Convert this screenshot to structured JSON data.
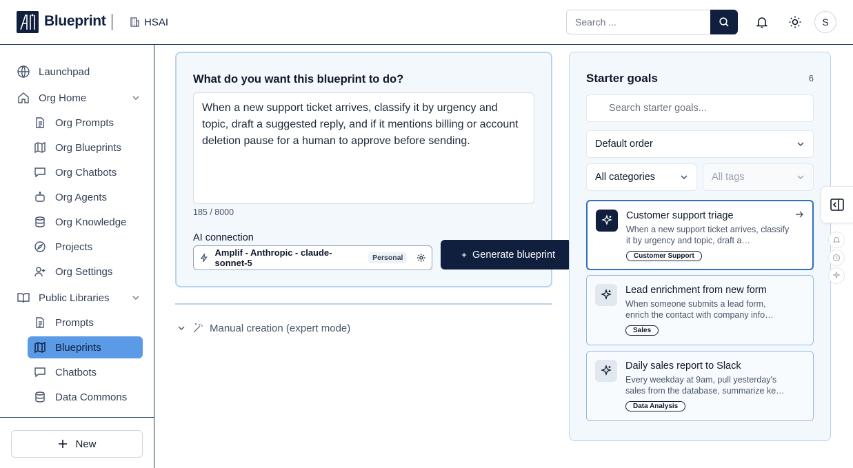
{
  "header": {
    "brand": "Blueprint",
    "org_name": "HSAI",
    "search_placeholder": "Search ...",
    "avatar_initial": "S"
  },
  "sidebar": {
    "items": [
      {
        "label": "Launchpad",
        "icon": "globe-icon"
      },
      {
        "label": "Org Home",
        "icon": "home-icon"
      },
      {
        "label": "Org Prompts",
        "icon": "file-text-icon"
      },
      {
        "label": "Org Blueprints",
        "icon": "map-icon"
      },
      {
        "label": "Org Chatbots",
        "icon": "chat-icon"
      },
      {
        "label": "Org Agents",
        "icon": "bot-icon"
      },
      {
        "label": "Org Knowledge",
        "icon": "database-icon"
      },
      {
        "label": "Projects",
        "icon": "compass-icon"
      },
      {
        "label": "Org Settings",
        "icon": "user-plus-icon"
      },
      {
        "label": "Public Libraries",
        "icon": "book-icon"
      },
      {
        "label": "Prompts",
        "icon": "file-text-icon"
      },
      {
        "label": "Blueprints",
        "icon": "map-icon"
      },
      {
        "label": "Chatbots",
        "icon": "chat-icon"
      },
      {
        "label": "Data Commons",
        "icon": "database-icon"
      }
    ],
    "active": "Blueprints",
    "new_label": "New"
  },
  "main": {
    "prompt_title": "What do you want this blueprint to do?",
    "prompt_text": "When a new support ticket arrives, classify it by urgency and topic, draft a suggested reply, and if it mentions billing or account deletion pause for a human to approve before sending.",
    "char_count": "185 / 8000",
    "ai_connection_label": "AI connection",
    "ai_connection_value": "Amplif - Anthropic - claude-sonnet-5",
    "ai_connection_badge": "Personal",
    "generate_label": "Generate blueprint",
    "manual_label": "Manual creation (expert mode)"
  },
  "starter": {
    "title": "Starter goals",
    "count": "6",
    "search_placeholder": "Search starter goals...",
    "order_value": "Default order",
    "category_value": "All categories",
    "tags_value": "All tags",
    "goals": [
      {
        "title": "Customer support triage",
        "desc": "When a new support ticket arrives, classify it by urgency and topic, draft a…",
        "tag": "Customer Support"
      },
      {
        "title": "Lead enrichment from new form",
        "desc": "When someone submits a lead form, enrich the contact with company info…",
        "tag": "Sales"
      },
      {
        "title": "Daily sales report to Slack",
        "desc": "Every weekday at 9am, pull yesterday's sales from the database, summarize ke…",
        "tag": "Data Analysis"
      }
    ]
  },
  "colors": {
    "brand_navy": "#0f1f3d",
    "active_nav": "#5b9ae6",
    "card_border": "#b7d3f0",
    "card_bg": "#f3f8fd"
  }
}
